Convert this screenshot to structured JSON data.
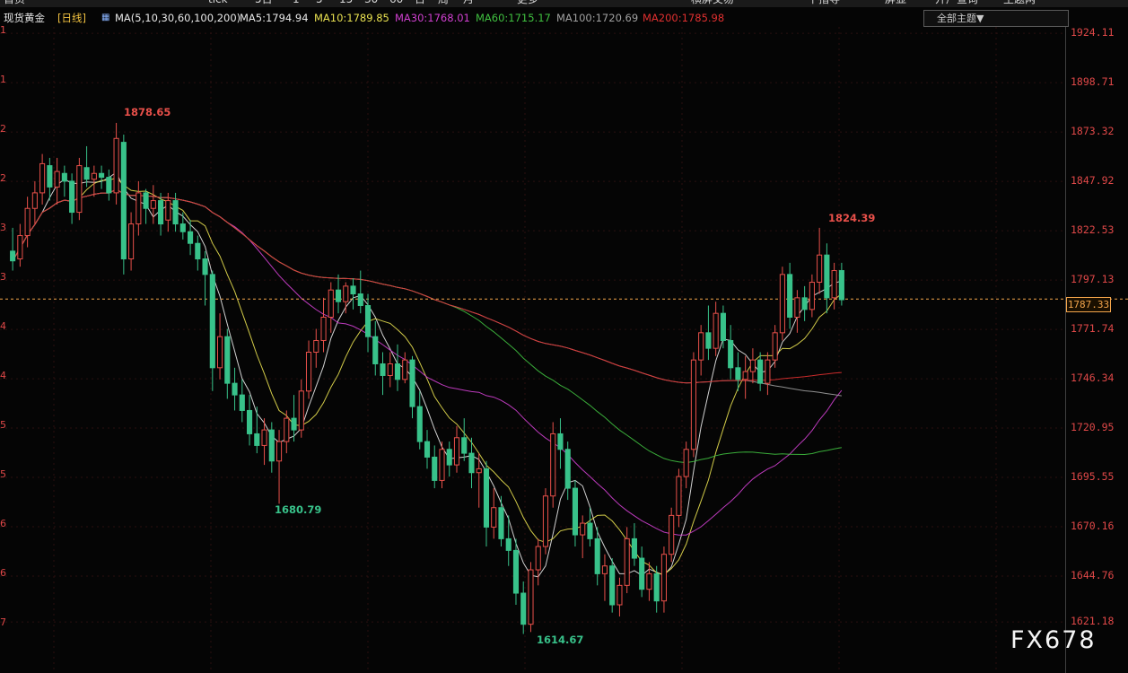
{
  "toolbar": {
    "items": [
      "首页",
      "",
      "",
      "tick",
      "5日",
      "1",
      "5",
      "15",
      "30",
      "60",
      "日",
      "周",
      "月",
      "",
      "更多",
      "",
      "",
      "",
      "",
      "横屏交易",
      "下指导",
      "",
      "屏显",
      "开户查询",
      "主题两"
    ]
  },
  "info": {
    "instrument": "现货黄金",
    "period": "[日线]",
    "ma_params": "MA(5,10,30,60,100,200)",
    "ma5": "MA5:1794.94",
    "ma10": "MA10:1789.85",
    "ma30": "MA30:1768.01",
    "ma60": "MA60:1715.17",
    "ma100": "MA100:1720.69",
    "ma200": "MA200:1785.98",
    "theme_select": "全部主题▼"
  },
  "colors": {
    "up": "#e8504a",
    "down": "#38c28a",
    "ma5": "#e8e8e8",
    "ma10": "#e8e050",
    "ma30": "#d040d0",
    "ma60": "#40c040",
    "ma100": "#a0a0a0",
    "ma200": "#e03030",
    "price_line": "#f3a54b"
  },
  "left_ticks": [
    "1",
    "1",
    "2",
    "2",
    "3",
    "3",
    "4",
    "4",
    "5",
    "5",
    "6",
    "6",
    "7"
  ],
  "current_price": "1787.33",
  "annotations": {
    "high1": "1878.65",
    "low1": "1680.79",
    "low2": "1614.67",
    "high2": "1824.39"
  },
  "watermark": "FX678",
  "chart_data": {
    "type": "candlestick",
    "title": "现货黄金 [日线]",
    "ylim": [
      1618,
      1926
    ],
    "y_ticks": [
      1924.11,
      1898.71,
      1873.32,
      1847.92,
      1822.53,
      1797.13,
      1771.74,
      1746.34,
      1720.95,
      1695.55,
      1670.16,
      1644.76,
      1621.18
    ],
    "candles": [
      [
        1812,
        1824,
        1802,
        1807
      ],
      [
        1808,
        1826,
        1804,
        1820
      ],
      [
        1820,
        1840,
        1814,
        1834
      ],
      [
        1834,
        1848,
        1826,
        1842
      ],
      [
        1842,
        1862,
        1836,
        1857
      ],
      [
        1856,
        1860,
        1838,
        1845
      ],
      [
        1845,
        1860,
        1836,
        1853
      ],
      [
        1852,
        1856,
        1840,
        1848
      ],
      [
        1848,
        1852,
        1826,
        1832
      ],
      [
        1832,
        1860,
        1828,
        1856
      ],
      [
        1855,
        1866,
        1845,
        1849
      ],
      [
        1849,
        1856,
        1840,
        1852
      ],
      [
        1852,
        1856,
        1844,
        1850
      ],
      [
        1850,
        1854,
        1838,
        1842
      ],
      [
        1842,
        1878,
        1836,
        1870
      ],
      [
        1868,
        1872,
        1800,
        1808
      ],
      [
        1808,
        1832,
        1802,
        1826
      ],
      [
        1826,
        1848,
        1820,
        1842
      ],
      [
        1842,
        1844,
        1826,
        1834
      ],
      [
        1834,
        1846,
        1826,
        1838
      ],
      [
        1838,
        1842,
        1820,
        1826
      ],
      [
        1828,
        1842,
        1822,
        1838
      ],
      [
        1838,
        1842,
        1822,
        1826
      ],
      [
        1826,
        1832,
        1818,
        1822
      ],
      [
        1822,
        1828,
        1810,
        1816
      ],
      [
        1816,
        1820,
        1802,
        1808
      ],
      [
        1808,
        1812,
        1784,
        1800
      ],
      [
        1800,
        1802,
        1740,
        1752
      ],
      [
        1752,
        1780,
        1746,
        1768
      ],
      [
        1768,
        1772,
        1736,
        1744
      ],
      [
        1744,
        1752,
        1730,
        1738
      ],
      [
        1738,
        1746,
        1724,
        1730
      ],
      [
        1730,
        1738,
        1712,
        1718
      ],
      [
        1718,
        1732,
        1708,
        1712
      ],
      [
        1712,
        1726,
        1702,
        1720
      ],
      [
        1720,
        1724,
        1698,
        1704
      ],
      [
        1704,
        1720,
        1682,
        1714
      ],
      [
        1714,
        1730,
        1708,
        1726
      ],
      [
        1726,
        1738,
        1714,
        1720
      ],
      [
        1720,
        1746,
        1716,
        1740
      ],
      [
        1740,
        1766,
        1736,
        1760
      ],
      [
        1760,
        1772,
        1752,
        1766
      ],
      [
        1766,
        1788,
        1760,
        1778
      ],
      [
        1778,
        1796,
        1770,
        1792
      ],
      [
        1792,
        1800,
        1780,
        1786
      ],
      [
        1786,
        1796,
        1780,
        1794
      ],
      [
        1794,
        1798,
        1782,
        1790
      ],
      [
        1790,
        1802,
        1780,
        1784
      ],
      [
        1784,
        1790,
        1760,
        1768
      ],
      [
        1768,
        1776,
        1748,
        1754
      ],
      [
        1754,
        1760,
        1738,
        1748
      ],
      [
        1748,
        1760,
        1742,
        1754
      ],
      [
        1754,
        1764,
        1740,
        1746
      ],
      [
        1746,
        1760,
        1744,
        1756
      ],
      [
        1756,
        1758,
        1726,
        1732
      ],
      [
        1732,
        1740,
        1710,
        1714
      ],
      [
        1714,
        1720,
        1700,
        1706
      ],
      [
        1706,
        1712,
        1690,
        1694
      ],
      [
        1694,
        1714,
        1690,
        1710
      ],
      [
        1710,
        1714,
        1696,
        1702
      ],
      [
        1702,
        1722,
        1698,
        1716
      ],
      [
        1716,
        1726,
        1704,
        1708
      ],
      [
        1708,
        1716,
        1690,
        1698
      ],
      [
        1698,
        1708,
        1680,
        1700
      ],
      [
        1700,
        1704,
        1660,
        1670
      ],
      [
        1670,
        1690,
        1664,
        1680
      ],
      [
        1680,
        1686,
        1660,
        1664
      ],
      [
        1664,
        1676,
        1650,
        1658
      ],
      [
        1658,
        1664,
        1630,
        1636
      ],
      [
        1636,
        1642,
        1615,
        1620
      ],
      [
        1620,
        1652,
        1616,
        1648
      ],
      [
        1648,
        1664,
        1640,
        1660
      ],
      [
        1660,
        1690,
        1656,
        1686
      ],
      [
        1686,
        1724,
        1680,
        1718
      ],
      [
        1718,
        1726,
        1700,
        1710
      ],
      [
        1710,
        1714,
        1684,
        1690
      ],
      [
        1690,
        1694,
        1660,
        1666
      ],
      [
        1666,
        1676,
        1654,
        1672
      ],
      [
        1672,
        1680,
        1660,
        1664
      ],
      [
        1664,
        1670,
        1640,
        1646
      ],
      [
        1646,
        1656,
        1632,
        1650
      ],
      [
        1650,
        1654,
        1626,
        1630
      ],
      [
        1630,
        1644,
        1624,
        1640
      ],
      [
        1640,
        1670,
        1636,
        1664
      ],
      [
        1664,
        1672,
        1650,
        1654
      ],
      [
        1654,
        1660,
        1634,
        1638
      ],
      [
        1638,
        1652,
        1632,
        1646
      ],
      [
        1646,
        1650,
        1626,
        1632
      ],
      [
        1632,
        1660,
        1626,
        1656
      ],
      [
        1656,
        1680,
        1652,
        1676
      ],
      [
        1676,
        1700,
        1670,
        1696
      ],
      [
        1696,
        1714,
        1690,
        1710
      ],
      [
        1710,
        1760,
        1706,
        1756
      ],
      [
        1756,
        1774,
        1748,
        1770
      ],
      [
        1770,
        1784,
        1756,
        1762
      ],
      [
        1762,
        1786,
        1758,
        1780
      ],
      [
        1780,
        1784,
        1762,
        1766
      ],
      [
        1766,
        1774,
        1746,
        1752
      ],
      [
        1752,
        1760,
        1740,
        1746
      ],
      [
        1746,
        1758,
        1736,
        1750
      ],
      [
        1750,
        1762,
        1744,
        1756
      ],
      [
        1756,
        1760,
        1740,
        1744
      ],
      [
        1744,
        1760,
        1738,
        1756
      ],
      [
        1756,
        1774,
        1752,
        1770
      ],
      [
        1770,
        1804,
        1766,
        1800
      ],
      [
        1800,
        1806,
        1772,
        1778
      ],
      [
        1778,
        1792,
        1770,
        1788
      ],
      [
        1788,
        1794,
        1776,
        1782
      ],
      [
        1782,
        1800,
        1778,
        1796
      ],
      [
        1796,
        1824,
        1790,
        1810
      ],
      [
        1810,
        1816,
        1780,
        1788
      ],
      [
        1788,
        1806,
        1782,
        1802
      ],
      [
        1802,
        1806,
        1784,
        1787
      ]
    ]
  }
}
